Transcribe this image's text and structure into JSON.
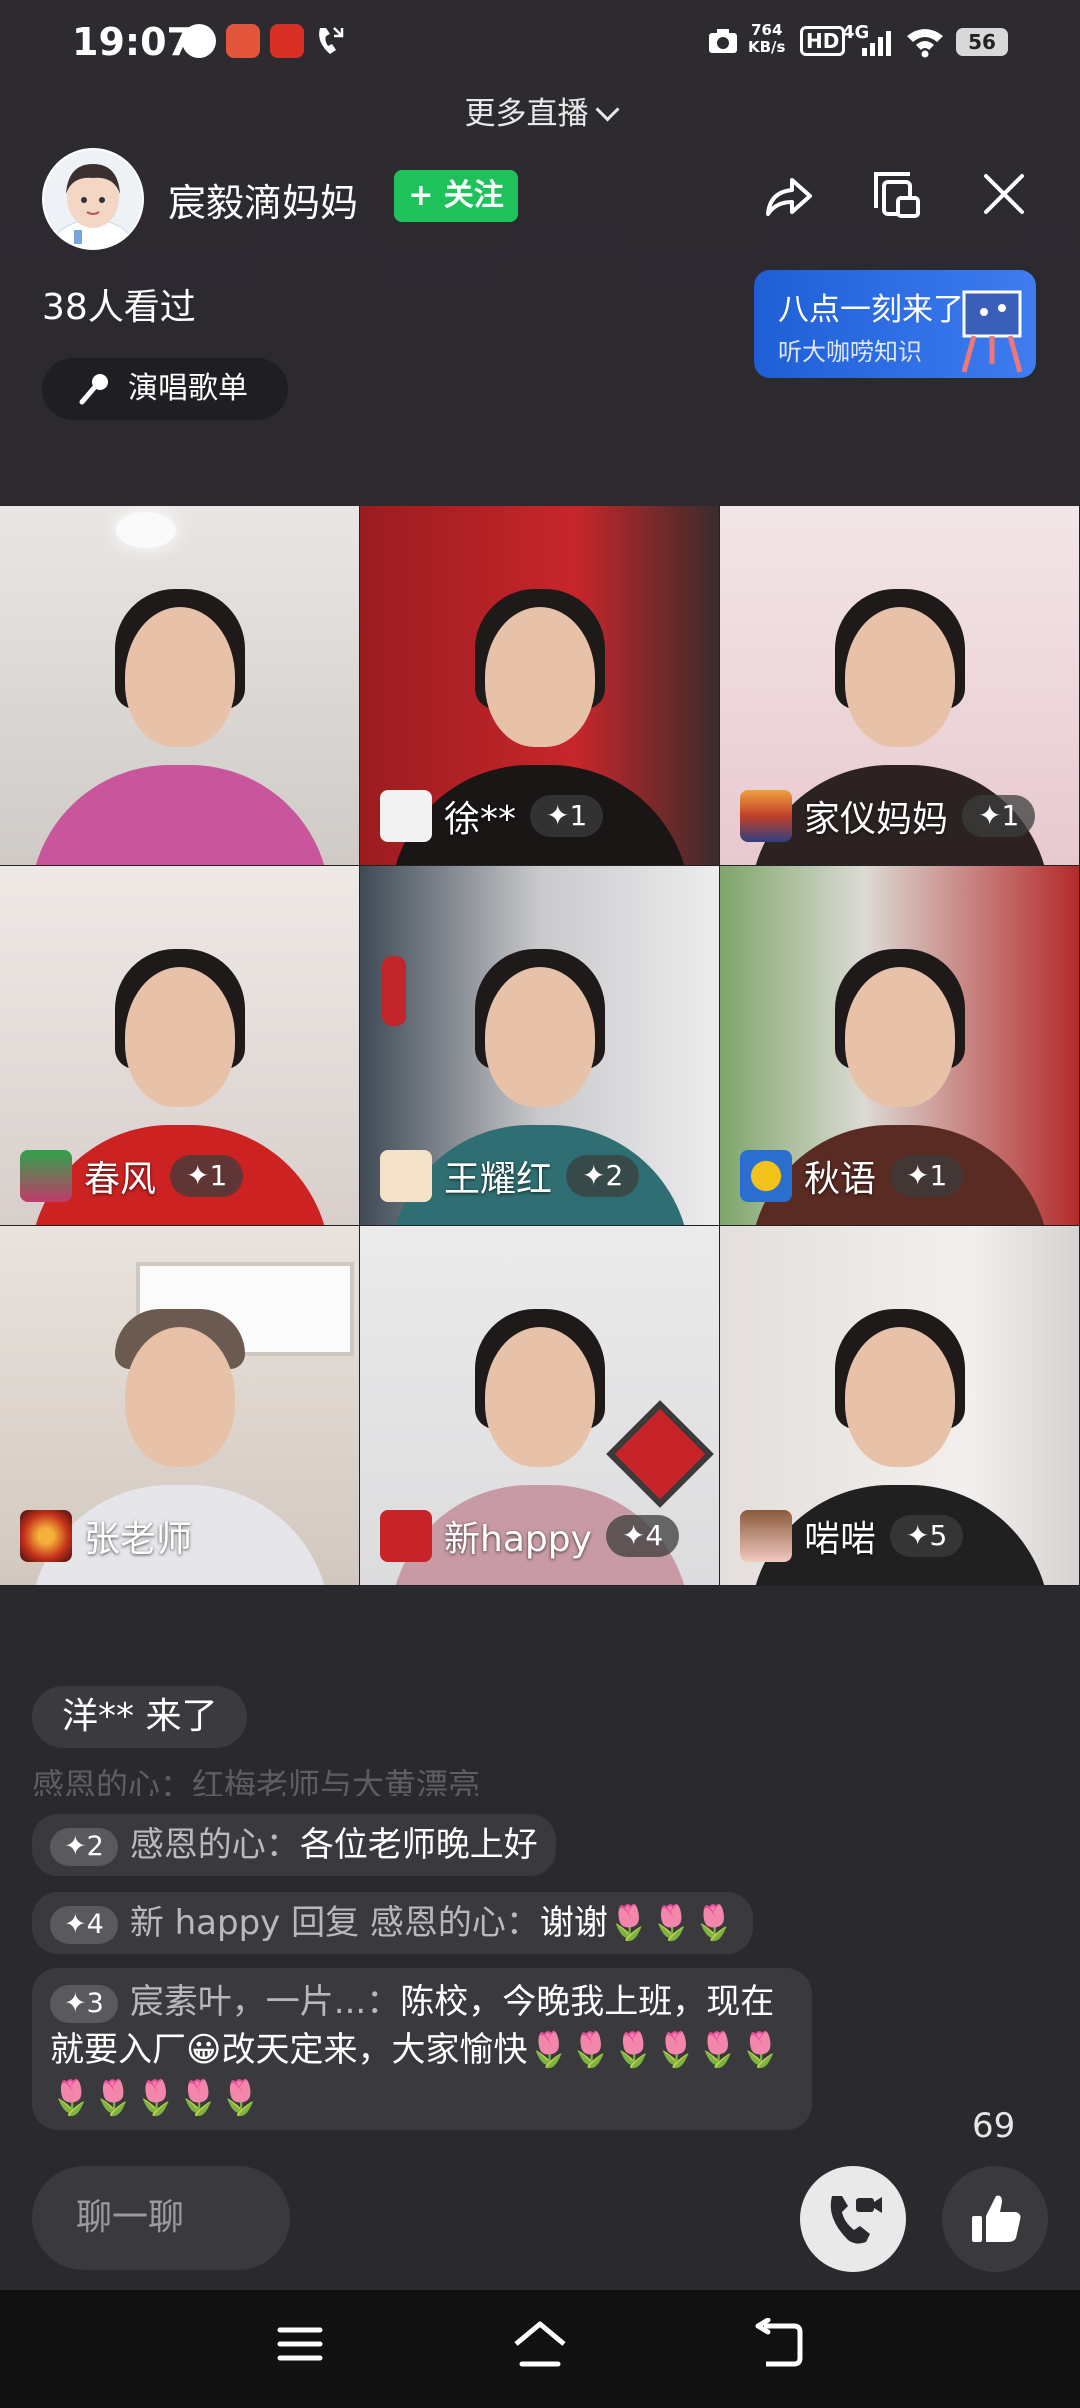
{
  "status_bar": {
    "time": "19:07",
    "speed_value": "764",
    "speed_unit": "KB/s",
    "hd": "HD",
    "network": "4G",
    "battery": "56"
  },
  "header": {
    "more_live": "更多直播",
    "host_name": "宸毅滴妈妈",
    "follow_label": "+ 关注",
    "viewers": "38人看过",
    "song_list": "演唱歌单"
  },
  "promo": {
    "title": "八点一刻来了",
    "subtitle": "听大咖唠知识"
  },
  "participants": [
    {
      "name": "",
      "badge": ""
    },
    {
      "name": "徐**",
      "badge": "✦1"
    },
    {
      "name": "家仪妈妈",
      "badge": "✦1"
    },
    {
      "name": "春风",
      "badge": "✦1"
    },
    {
      "name": "王耀红",
      "badge": "✦2"
    },
    {
      "name": "秋语",
      "badge": "✦1"
    },
    {
      "name": "张老师",
      "badge": ""
    },
    {
      "name": "新happy",
      "badge": "✦4"
    },
    {
      "name": "啱啱",
      "badge": "✦5"
    }
  ],
  "chat": {
    "join_notice": "洋** 来了",
    "faded_line": "感恩的心：红梅老师与大黄漂亮",
    "messages": [
      {
        "level": "✦2",
        "user": "感恩的心：",
        "text": "各位老师晚上好"
      },
      {
        "level": "✦4",
        "user": "新 happy 回复 感恩的心：",
        "text": "谢谢🌷🌷🌷"
      },
      {
        "level": "✦3",
        "user": "宸素叶，一片...：",
        "text": "陈校，今晚我上班，现在就要入厂😀改天定来，大家愉快🌷🌷🌷🌷🌷🌷🌷🌷🌷🌷🌷"
      }
    ]
  },
  "bottom": {
    "likes": "69",
    "input_placeholder": "聊一聊"
  },
  "colors": {
    "follow_green": "#1fc25a",
    "promo_blue": "#2f6fe6"
  }
}
